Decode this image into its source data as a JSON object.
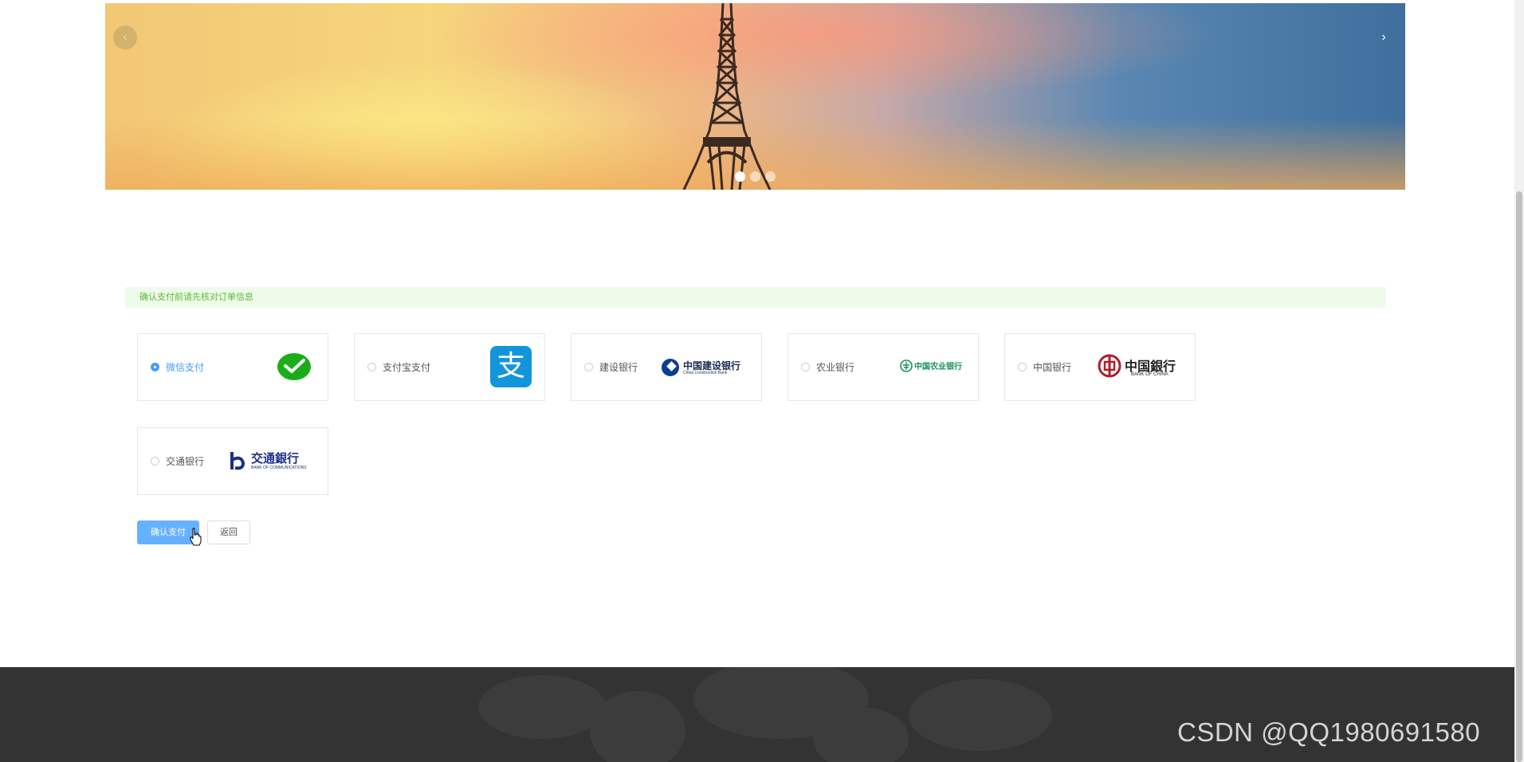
{
  "carousel": {
    "prev_icon": "‹",
    "next_icon": "›",
    "slide_count": 3,
    "active_slide": 1
  },
  "notice": "确认支付前请先核对订单信息",
  "payment_methods": [
    {
      "label": "微信支付",
      "selected": true,
      "icon": "wechat-pay-logo"
    },
    {
      "label": "支付宝支付",
      "selected": false,
      "icon": "alipay-logo",
      "logo_text": "支"
    },
    {
      "label": "建设银行",
      "selected": false,
      "icon": "ccb-logo",
      "logo_text": "中国建设银行",
      "logo_subtext": "China Construction Bank"
    },
    {
      "label": "农业银行",
      "selected": false,
      "icon": "abc-logo",
      "logo_text": "中国农业银行"
    },
    {
      "label": "中国银行",
      "selected": false,
      "icon": "boc-logo",
      "logo_text": "中国銀行",
      "logo_subtext": "BANK OF CHINA"
    },
    {
      "label": "交通银行",
      "selected": false,
      "icon": "bocom-logo",
      "logo_text": "交通銀行",
      "logo_subtext": "BANK OF COMMUNICATIONS"
    }
  ],
  "actions": {
    "confirm_label": "确认支付",
    "back_label": "返回"
  },
  "watermark": "CSDN @QQ1980691580",
  "colors": {
    "primary": "#66b1ff",
    "selected_text": "#409eff",
    "notice_bg": "#eefbea",
    "notice_text": "#5cb832",
    "footer_bg": "#333333"
  }
}
